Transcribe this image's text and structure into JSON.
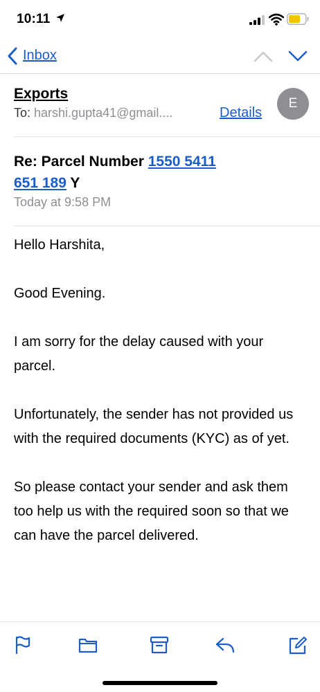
{
  "status": {
    "time": "10:11"
  },
  "nav": {
    "back_label": "Inbox"
  },
  "email": {
    "sender": "Exports",
    "to_prefix": "To:",
    "to_address": "harshi.gupta41@gmail....",
    "details_label": "Details",
    "avatar_initial": "E",
    "subject_prefix": "Re: Parcel Number ",
    "subject_number_line1": "1550 5411",
    "subject_number_line2": "651 189",
    "subject_suffix": " Y",
    "date": "Today at 9:58 PM",
    "body": [
      "Hello Harshita,",
      "Good Evening.",
      "I am sorry for the delay caused with your parcel.",
      "Unfortunately, the sender has not provided us with the required documents (KYC) as of yet.",
      "So please contact your sender and ask them too help us with the required soon so that we can have the parcel delivered."
    ]
  },
  "colors": {
    "accent": "#1a5dc9",
    "secondary_text": "#8e8e93",
    "avatar_bg": "#8e8e93",
    "battery_fill": "#f5c400"
  },
  "toolbar": {
    "icons": [
      "flag-icon",
      "folder-icon",
      "archive-icon",
      "reply-icon",
      "compose-icon"
    ]
  }
}
